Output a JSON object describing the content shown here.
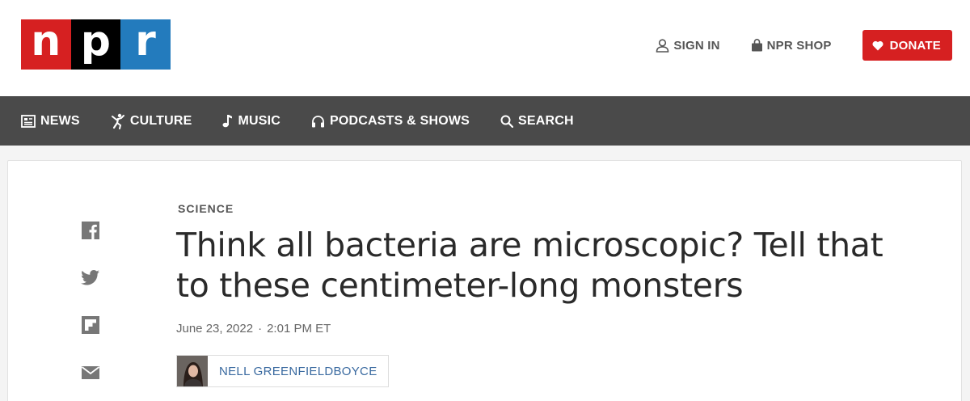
{
  "brand": {
    "logo_letters": [
      "n",
      "p",
      "r"
    ],
    "colors": {
      "n": "#d62021",
      "p": "#000000",
      "r": "#237bbd"
    }
  },
  "header": {
    "sign_in": {
      "label": "SIGN IN",
      "icon": "user-icon"
    },
    "shop": {
      "label": "NPR SHOP",
      "icon": "shopping-bag-icon"
    },
    "donate": {
      "label": "DONATE",
      "icon": "heart-icon",
      "color": "#d62021"
    }
  },
  "nav": {
    "items": [
      {
        "label": "NEWS",
        "icon": "newspaper-icon"
      },
      {
        "label": "CULTURE",
        "icon": "dancer-icon"
      },
      {
        "label": "MUSIC",
        "icon": "music-note-icon"
      },
      {
        "label": "PODCASTS & SHOWS",
        "icon": "headphones-icon"
      },
      {
        "label": "SEARCH",
        "icon": "search-icon"
      }
    ],
    "background": "#4a4a4a"
  },
  "share": [
    "facebook-icon",
    "twitter-icon",
    "flipboard-icon",
    "email-icon"
  ],
  "article": {
    "section": "SCIENCE",
    "headline": "Think all bacteria are microscopic? Tell that to these centimeter-long monsters",
    "date": "June 23, 2022",
    "separator": "·",
    "time": "2:01 PM ET",
    "author": "NELL GREENFIELDBOYCE"
  }
}
